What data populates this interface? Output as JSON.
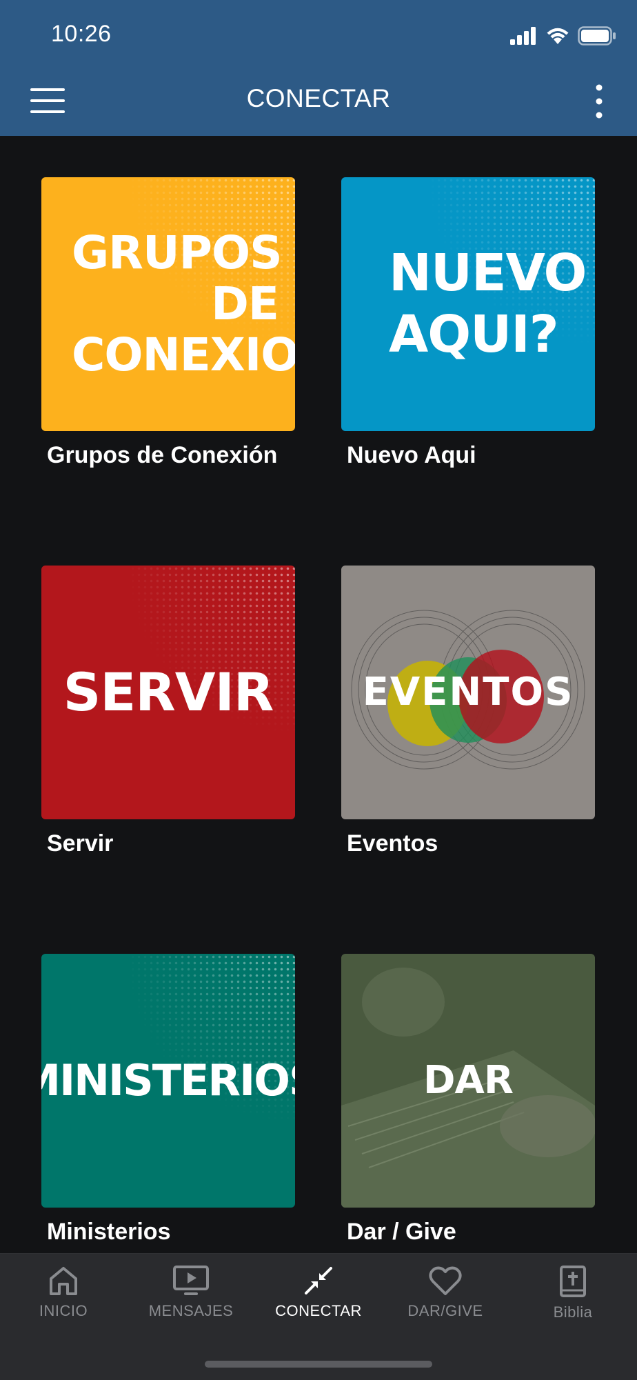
{
  "status": {
    "time": "10:26"
  },
  "header": {
    "title": "CONECTAR"
  },
  "cards": [
    {
      "tile_text": "GRUPOS DE CONEXION",
      "label": "Grupos de Conexión",
      "color": "#fdb11d"
    },
    {
      "tile_text": "NUEVO AQUI?",
      "label": "Nuevo Aqui",
      "color": "#0596c6"
    },
    {
      "tile_text": "SERVIR",
      "label": "Servir",
      "color": "#b3171c"
    },
    {
      "tile_text": "EVENTOS",
      "label": "Eventos",
      "color": "#8f8a86"
    },
    {
      "tile_text": "MINISTERIOS",
      "label": "Ministerios",
      "color": "#00766a"
    },
    {
      "tile_text": "DAR",
      "label": "Dar / Give",
      "color": "#4a5a3f"
    }
  ],
  "tabs": [
    {
      "label": "INICIO",
      "icon": "home-icon",
      "active": false
    },
    {
      "label": "MENSAJES",
      "icon": "play-screen-icon",
      "active": false
    },
    {
      "label": "CONECTAR",
      "icon": "arrows-in-icon",
      "active": true
    },
    {
      "label": "DAR/GIVE",
      "icon": "heart-icon",
      "active": false
    },
    {
      "label": "Biblia",
      "icon": "bible-icon",
      "active": false
    }
  ]
}
